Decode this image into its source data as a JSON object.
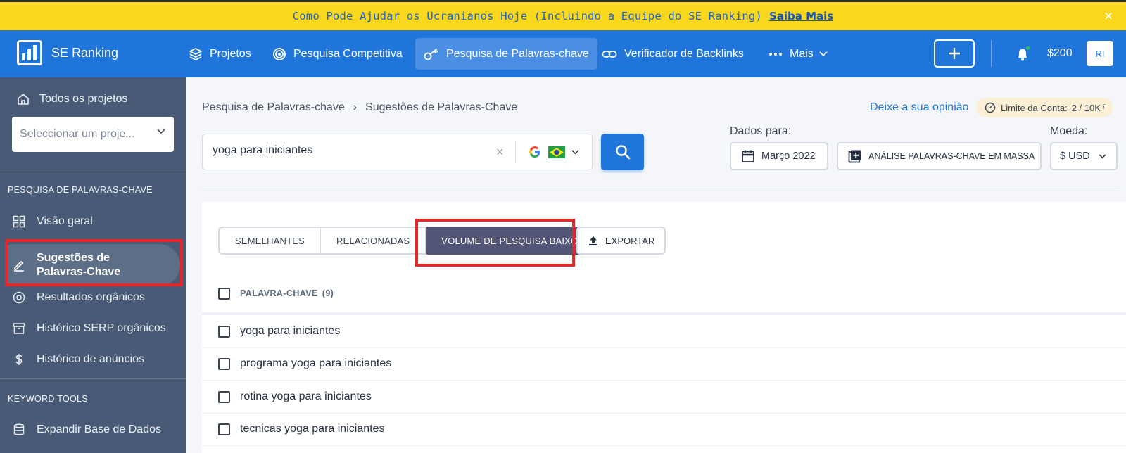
{
  "banner": {
    "text": "Como Pode Ajudar os Ucranianos Hoje (Incluindo a Equipe do SE Ranking)",
    "link": "Saiba Mais",
    "close": "×"
  },
  "topnav": {
    "brand": "SE Ranking",
    "items": [
      {
        "label": "Projetos",
        "icon": "layers-icon"
      },
      {
        "label": "Pesquisa Competitiva",
        "icon": "target-icon"
      },
      {
        "label": "Pesquisa de Palavras-chave",
        "icon": "key-icon",
        "active": true
      },
      {
        "label": "Verificador de Backlinks",
        "icon": "link-icon"
      },
      {
        "label": "Mais",
        "icon": "more-icon"
      }
    ],
    "balance": "$200",
    "avatar": "RI"
  },
  "sidebar": {
    "all_projects": "Todos os projetos",
    "project_placeholder": "Seleccionar um proje...",
    "section1": "PESQUISA DE PALAVRAS-CHAVE",
    "items": [
      {
        "label": "Visão geral",
        "icon": "grid-icon"
      },
      {
        "label": "Sugestões de Palavras-Chave",
        "icon": "pencil-icon",
        "active": true
      },
      {
        "label": "Resultados orgânicos",
        "icon": "circle-target-icon"
      },
      {
        "label": "Histórico SERP orgânicos",
        "icon": "archive-icon"
      },
      {
        "label": "Histórico de anúncios",
        "icon": "dollar-icon"
      }
    ],
    "section2": "KEYWORD TOOLS",
    "items2": [
      {
        "label": "Expandir Base de Dados",
        "icon": "database-icon"
      }
    ]
  },
  "breadcrumb": {
    "parent": "Pesquisa de Palavras-chave",
    "separator": "›",
    "current": "Sugestões de Palavras-Chave"
  },
  "feedback": "Deixe a sua opinião",
  "limit": {
    "label": "Limite da Conta:",
    "value": "2 / 10K",
    "info": "i"
  },
  "search": {
    "value": "yoga para iniciantes",
    "clear": "×"
  },
  "date": {
    "label": "Dados para:",
    "value": "Março 2022"
  },
  "bulk": "ANÁLISE PALAVRAS-CHAVE EM MASSA",
  "currency": {
    "label": "Moeda:",
    "value": "$ USD"
  },
  "tabs": [
    "SEMELHANTES",
    "RELACIONADAS",
    "VOLUME DE PESQUISA BAIXO"
  ],
  "export": "EXPORTAR",
  "table": {
    "header": "PALAVRA-CHAVE",
    "count": "(9)",
    "rows": [
      "yoga para iniciantes",
      "programa yoga para iniciantes",
      "rotina yoga para iniciantes",
      "tecnicas yoga para iniciantes"
    ]
  },
  "colors": {
    "primary": "#1f75d9",
    "banner": "#f9d71c",
    "sidebar": "#485a75",
    "active_tab": "#535577",
    "highlight": "#e8262a"
  }
}
